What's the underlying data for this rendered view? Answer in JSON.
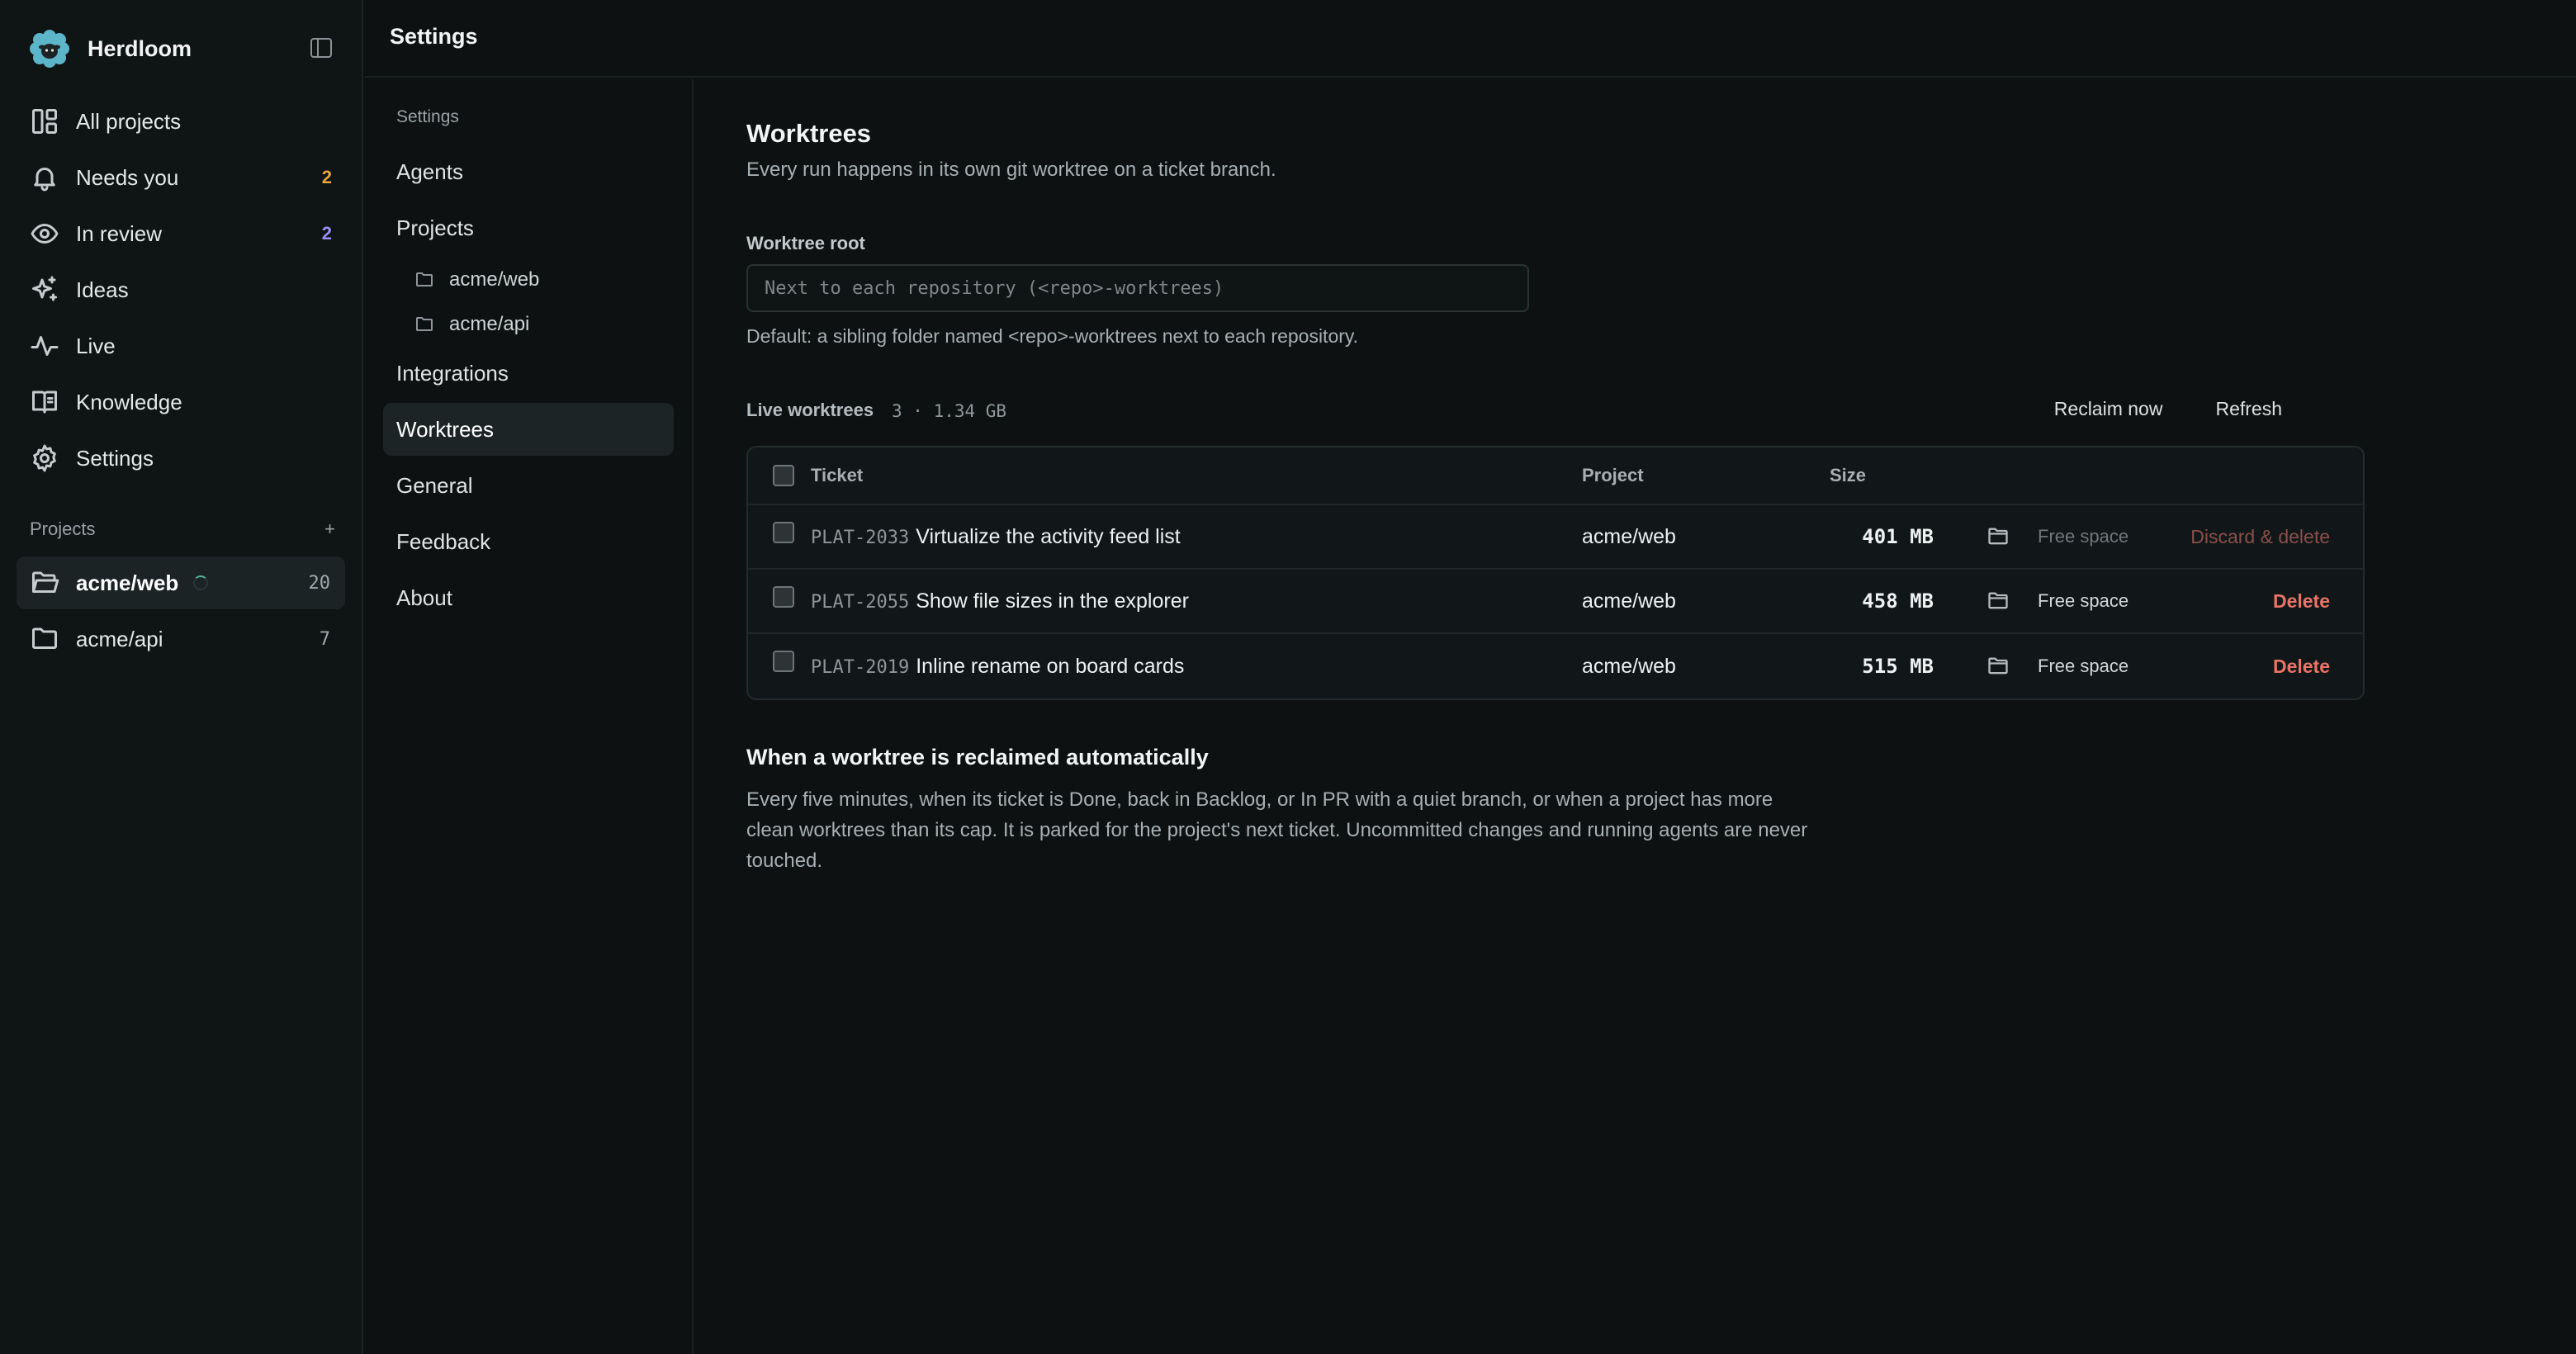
{
  "app": {
    "name": "Herdloom",
    "logo_icon": "sheep-logo-icon",
    "accent": "#4fb0c6"
  },
  "nav": [
    {
      "label": "All projects",
      "icon": "grid-icon"
    },
    {
      "label": "Needs you",
      "icon": "bell-icon",
      "count": "2",
      "count_color": "#e8a43f"
    },
    {
      "label": "In review",
      "icon": "eye-icon",
      "count": "2",
      "count_color": "#9b8ff5"
    },
    {
      "label": "Ideas",
      "icon": "sparkle-icon"
    },
    {
      "label": "Live",
      "icon": "pulse-icon"
    },
    {
      "label": "Knowledge",
      "icon": "book-icon"
    },
    {
      "label": "Settings",
      "icon": "gear-icon"
    }
  ],
  "projects": {
    "heading": "Projects",
    "items": [
      {
        "label": "acme/web",
        "count": "20",
        "active": true
      },
      {
        "label": "acme/api",
        "count": "7",
        "active": false
      }
    ]
  },
  "topbar": {
    "title": "Settings"
  },
  "settings_nav": {
    "heading": "Settings",
    "items": [
      "Agents",
      "Projects",
      "Integrations",
      "Worktrees",
      "General",
      "Feedback",
      "About"
    ],
    "project_children": [
      "acme/web",
      "acme/api"
    ],
    "active": "Worktrees"
  },
  "worktrees": {
    "title": "Worktrees",
    "description": "Every run happens in its own git worktree on a ticket branch.",
    "root_label": "Worktree root",
    "root_placeholder": "Next to each repository (<repo>-worktrees)",
    "root_hint": "Default: a sibling folder named <repo>-worktrees next to each repository.",
    "live_heading": "Live worktrees",
    "live_meta": "3 · 1.34 GB",
    "reclaim_label": "Reclaim now",
    "refresh_label": "Refresh",
    "columns": {
      "ticket": "Ticket",
      "project": "Project",
      "size": "Size"
    },
    "rows": [
      {
        "id": "PLAT-2033",
        "title": "Virtualize the activity feed list",
        "project": "acme/web",
        "size": "401 MB",
        "free": "Free space",
        "action": "Discard & delete"
      },
      {
        "id": "PLAT-2055",
        "title": "Show file sizes in the explorer",
        "project": "acme/web",
        "size": "458 MB",
        "free": "Free space",
        "action": "Delete"
      },
      {
        "id": "PLAT-2019",
        "title": "Inline rename on board cards",
        "project": "acme/web",
        "size": "515 MB",
        "free": "Free space",
        "action": "Delete"
      }
    ],
    "auto_title": "When a worktree is reclaimed automatically",
    "auto_text": "Every five minutes, when its ticket is Done, back in Backlog, or In PR with a quiet branch, or when a project has more clean worktrees than its cap. It is parked for the project's next ticket. Uncommitted changes and running agents are never touched."
  }
}
